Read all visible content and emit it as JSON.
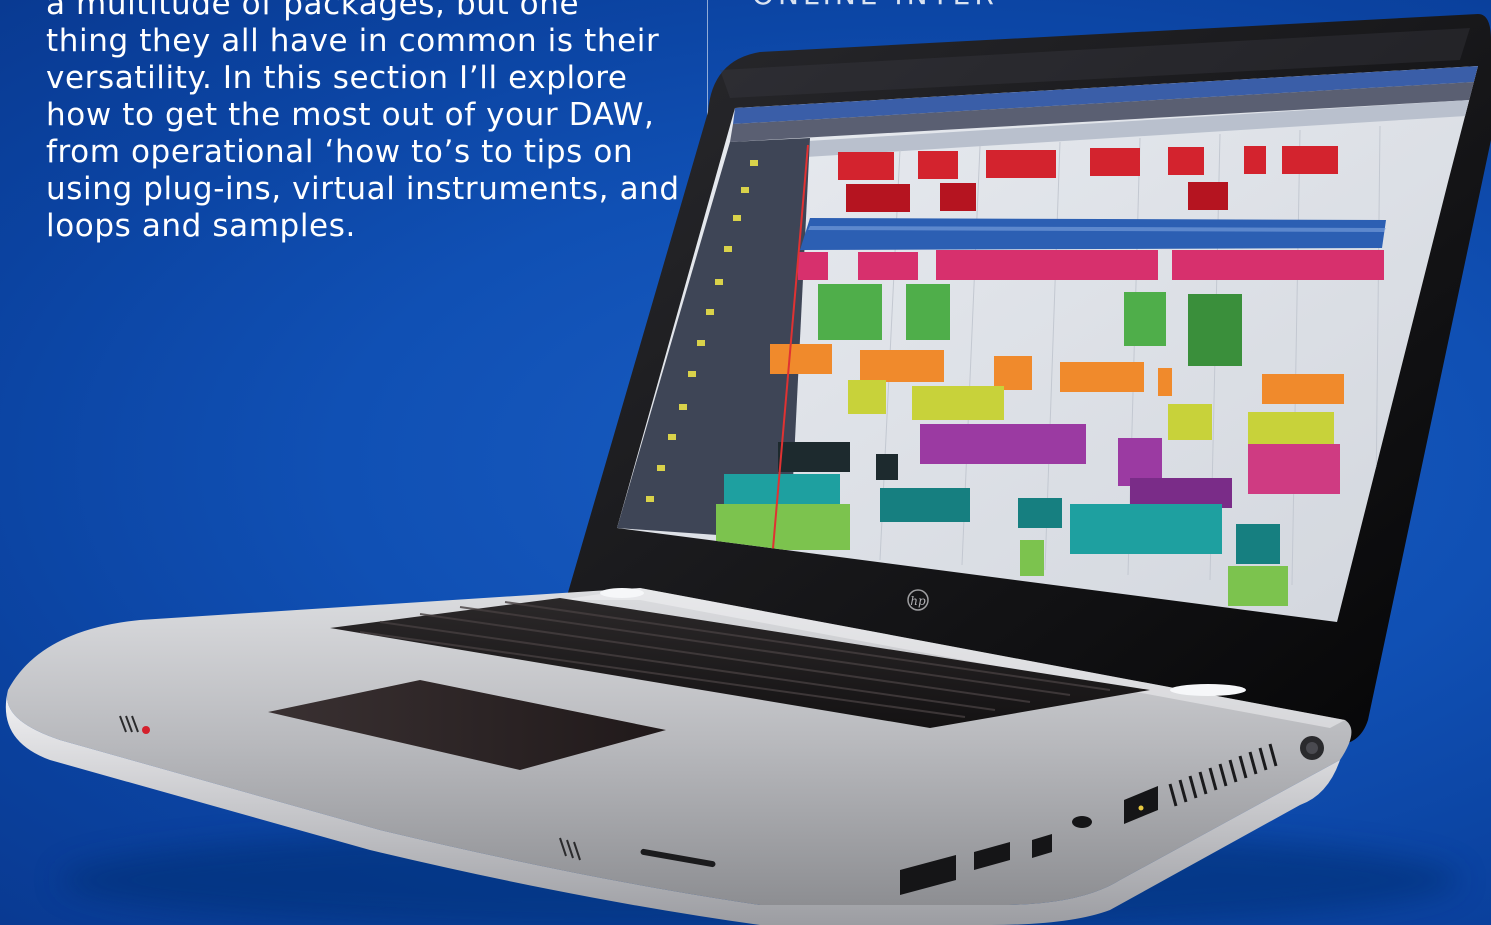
{
  "intro": {
    "lines": [
      "a multitude of packages, but one",
      "thing they all have in common is their",
      "versatility. In this section I’ll explore",
      "how to get the most out of your DAW,",
      "from operational ‘how to’s to tips on",
      "using plug-ins, virtual instruments, and",
      "loops and samples."
    ]
  },
  "cut_heading": "ONLINE INTER",
  "laptop": {
    "brand_logo": "hp",
    "screen_app": "DAW arrange window",
    "track_colors": [
      "#d3232e",
      "#2c5fb3",
      "#d7306d",
      "#4fae4a",
      "#f08a2c",
      "#c8d23a",
      "#9b3aa2",
      "#1ea0a0",
      "#7cc34e"
    ]
  },
  "colors": {
    "background": "#1050b4",
    "text": "#ffffff"
  }
}
